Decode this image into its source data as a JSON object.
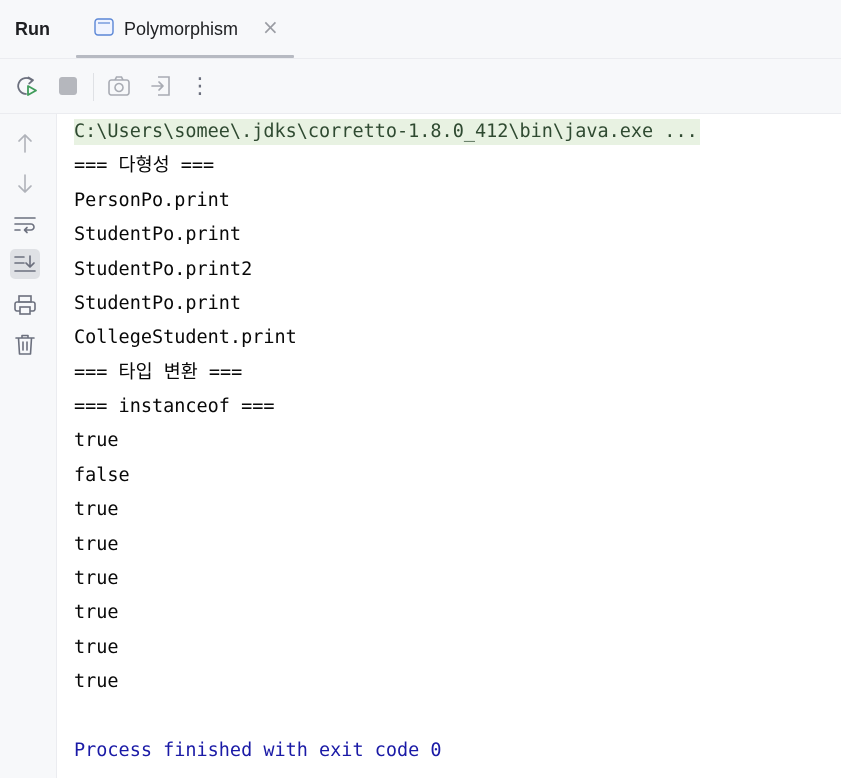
{
  "tabbar": {
    "run_label": "Run",
    "tab_title": "Polymorphism",
    "close_glyph": "×"
  },
  "toolbar": {
    "icons": [
      "rerun-icon",
      "stop-icon",
      "camera-icon",
      "restore-layout-icon",
      "more-options-icon"
    ],
    "more_glyph": "⋮"
  },
  "gutter": {
    "icons": [
      "scroll-up-icon",
      "scroll-down-icon",
      "soft-wrap-icon",
      "scroll-to-end-icon",
      "print-icon",
      "clear-all-icon"
    ]
  },
  "console": {
    "command": "C:\\Users\\somee\\.jdks\\corretto-1.8.0_412\\bin\\java.exe ...",
    "output_lines": [
      "=== 다형성 ===",
      "PersonPo.print",
      "StudentPo.print",
      "StudentPo.print2",
      "StudentPo.print",
      "CollegeStudent.print",
      "=== 타입 변환 ===",
      "=== instanceof ===",
      "true",
      "false",
      "true",
      "true",
      "true",
      "true",
      "true",
      "true"
    ],
    "exit_message": "Process finished with exit code 0"
  },
  "colors": {
    "command_bg": "#e8f2e2",
    "exit_text": "#1a1aa6"
  }
}
